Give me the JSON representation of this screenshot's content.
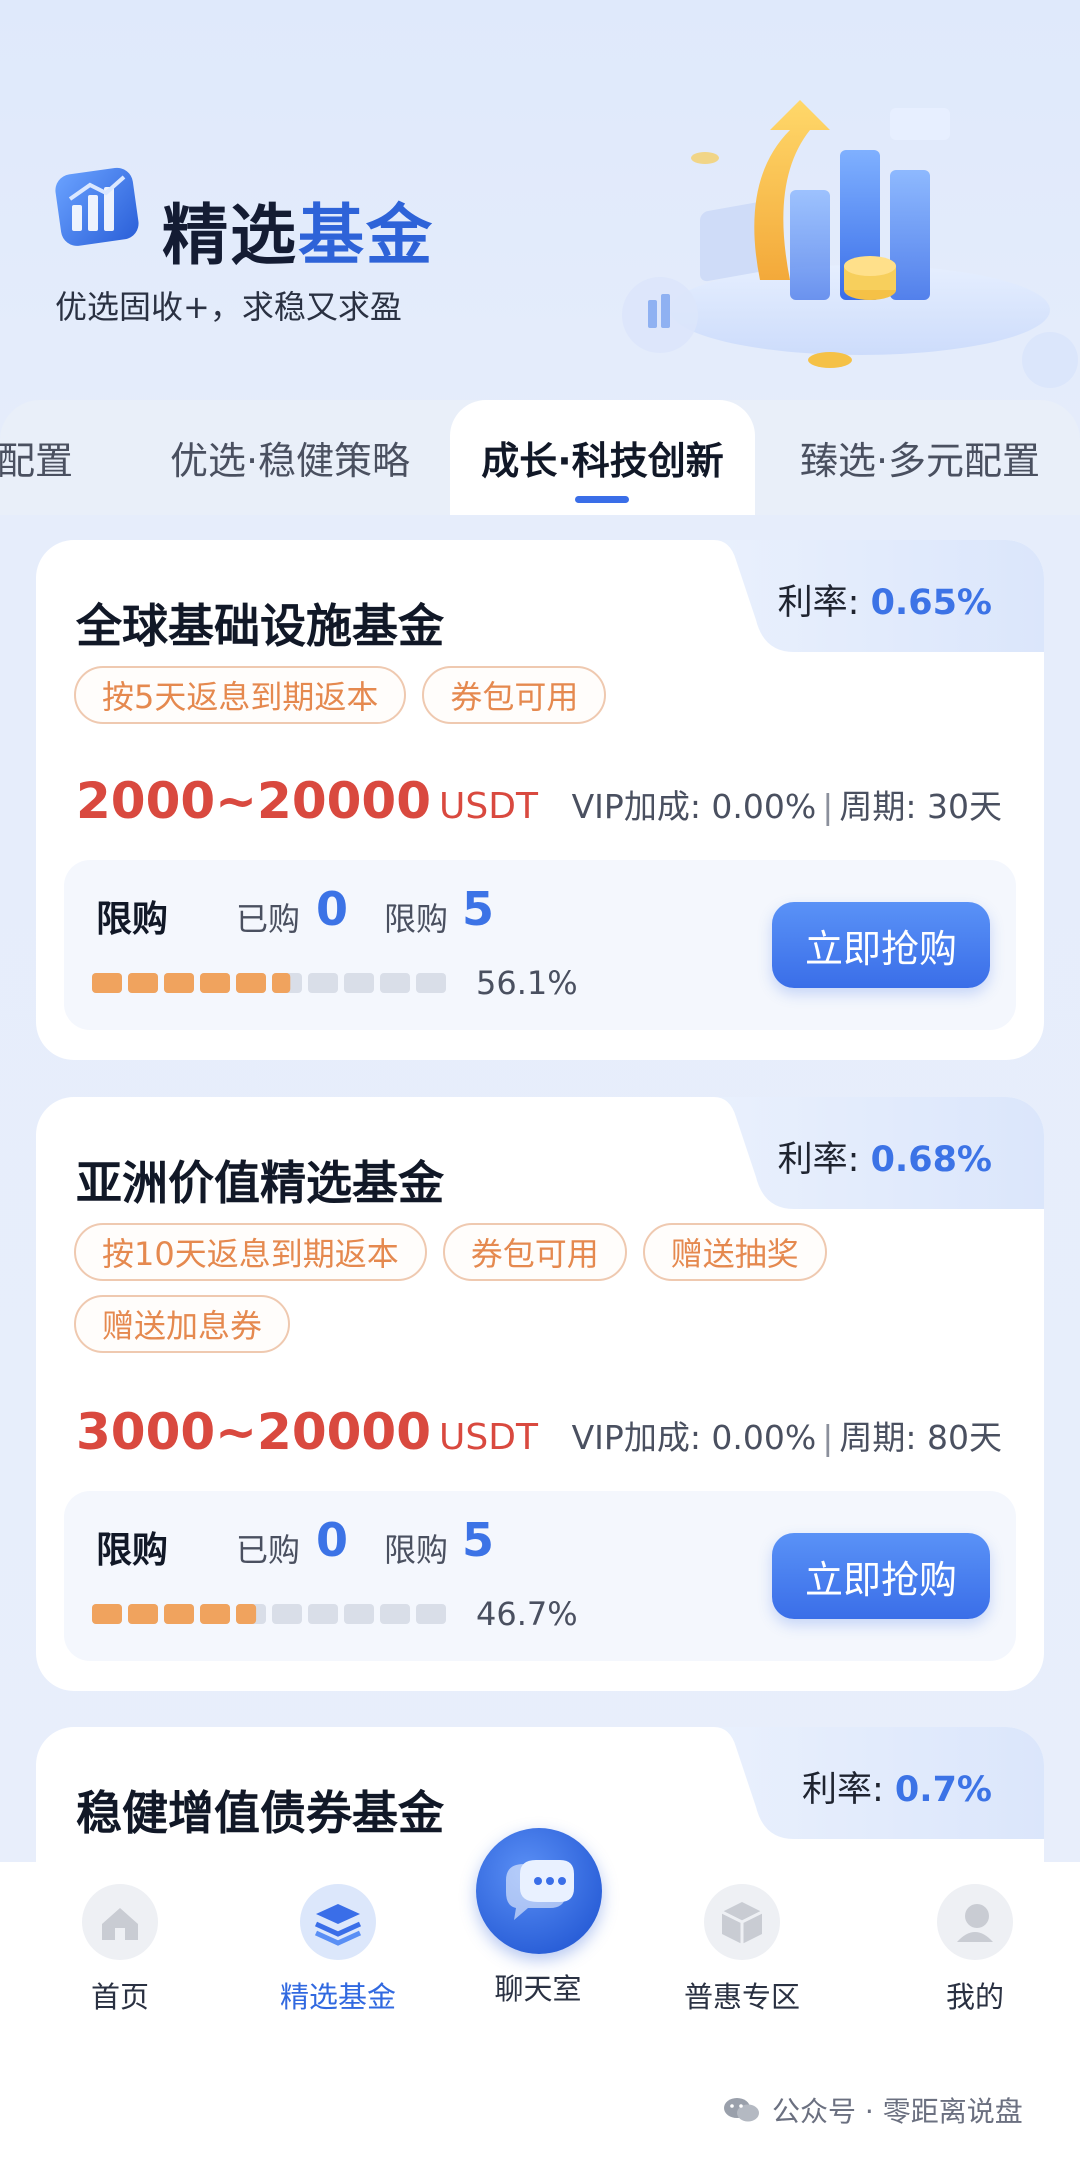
{
  "header": {
    "title_part1": "精选",
    "title_part2": "基金",
    "subtitle": "优选固收+，求稳又求盈",
    "logo_icon": "chart-bars-icon",
    "hero_icon": "growth-arrow-chart-illustration"
  },
  "tabs": [
    {
      "label": "配置",
      "active": false
    },
    {
      "label": "优选·稳健策略",
      "active": false
    },
    {
      "label": "成长·科技创新",
      "active": true
    },
    {
      "label": "臻选·多元配置",
      "active": false
    }
  ],
  "funds": [
    {
      "name": "全球基础设施基金",
      "rate_label": "利率:",
      "rate_value": "0.65%",
      "tags": [
        "按5天返息到期返本",
        "券包可用"
      ],
      "amount": "2000~20000",
      "unit": "USDT",
      "vip": "VIP加成: 0.00%",
      "sep": "|",
      "period": "周期: 30天",
      "limit_title": "限购",
      "bought_label": "已购",
      "bought_value": "0",
      "limit_label": "限购",
      "limit_value": "5",
      "progress": 0.561,
      "progress_text": "56.1%",
      "button": "立即抢购"
    },
    {
      "name": "亚洲价值精选基金",
      "rate_label": "利率:",
      "rate_value": "0.68%",
      "tags": [
        "按10天返息到期返本",
        "券包可用",
        "赠送抽奖",
        "赠送加息券"
      ],
      "amount": "3000~20000",
      "unit": "USDT",
      "vip": "VIP加成: 0.00%",
      "sep": "|",
      "period": "周期: 80天",
      "limit_title": "限购",
      "bought_label": "已购",
      "bought_value": "0",
      "limit_label": "限购",
      "limit_value": "5",
      "progress": 0.467,
      "progress_text": "46.7%",
      "button": "立即抢购"
    },
    {
      "name": "稳健增值债券基金",
      "rate_label": "利率:",
      "rate_value": "0.7%"
    }
  ],
  "nav": [
    {
      "label": "首页",
      "icon": "home-icon",
      "active": false
    },
    {
      "label": "精选基金",
      "icon": "layers-icon",
      "active": true
    },
    {
      "label": "聊天室",
      "icon": "chat-bubbles-icon",
      "active": false
    },
    {
      "label": "普惠专区",
      "icon": "cube-icon",
      "active": false
    },
    {
      "label": "我的",
      "icon": "user-icon",
      "active": false
    }
  ],
  "watermark": "公众号 · 零距离说盘",
  "colors": {
    "accent": "#3a6ee8",
    "amount_red": "#d9493f",
    "tag_orange": "#e5894f",
    "progress_orange": "#f0a35e",
    "progress_empty": "#d9dee8"
  }
}
